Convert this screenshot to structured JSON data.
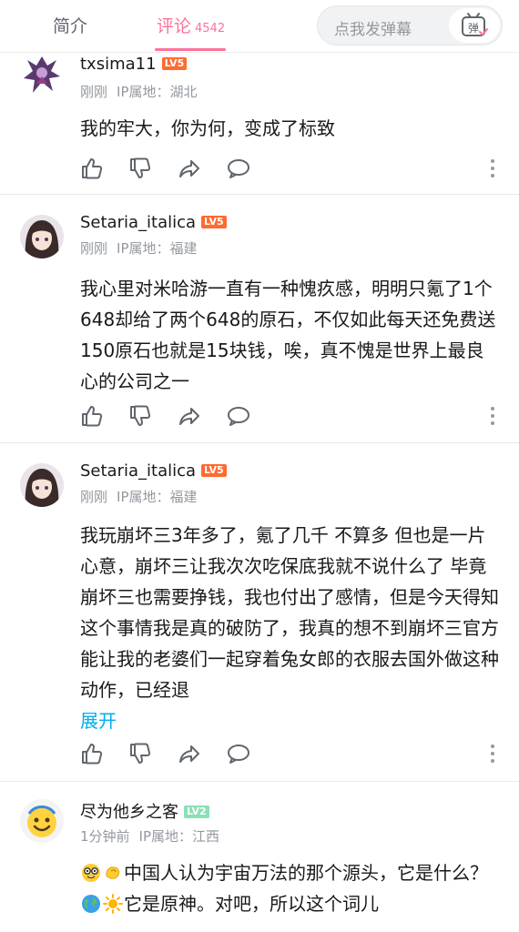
{
  "tabs": {
    "intro_label": "简介",
    "comments_label": "评论",
    "comments_count": "4542"
  },
  "danmaku": {
    "placeholder": "点我发弹幕",
    "button_icon": "danmaku-icon"
  },
  "comments": [
    {
      "username": "txsima11",
      "level": "LV5",
      "time": "刚刚",
      "ip": "IP属地：湖北",
      "text": "我的牢大，你为何，变成了标致"
    },
    {
      "username": "Setaria_italica",
      "level": "LV5",
      "time": "刚刚",
      "ip": "IP属地：福建",
      "text": "我心里对米哈游一直有一种愧疚感，明明只氪了1个648却给了两个648的原石，不仅如此每天还免费送150原石也就是15块钱，唉，真不愧是世界上最良心的公司之一"
    },
    {
      "username": "Setaria_italica",
      "level": "LV5",
      "time": "刚刚",
      "ip": "IP属地：福建",
      "text": "我玩崩坏三3年多了，氪了几千 不算多 但也是一片心意，崩坏三让我次次吃保底我就不说什么了 毕竟崩坏三也需要挣钱，我也付出了感情，但是今天得知这个事情我是真的破防了，我真的想不到崩坏三官方能让我的老婆们一起穿着兔女郎的衣服去国外做这种动作，已经退",
      "expand_label": "展开"
    },
    {
      "username": "尽为他乡之客",
      "level": "LV2",
      "time": "1分钟前",
      "ip": "IP属地：江西",
      "text_part1": "中国人认为宇宙万法的那个源头，它是什么？",
      "text_part2": "它是原神。对吧，所以这个词儿",
      "emojis": [
        "nerd-face-emoji",
        "pinching-hand-emoji",
        "globe-emoji",
        "sun-emoji"
      ]
    }
  ],
  "colors": {
    "accent": "#fb7299",
    "lv5": "#ff6a2f",
    "lv2": "#8be0b4",
    "link": "#00aeec",
    "meta": "#9499a0"
  }
}
